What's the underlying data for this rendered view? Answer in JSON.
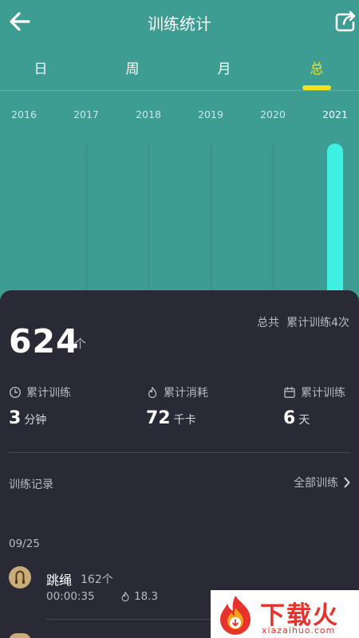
{
  "header": {
    "title": "训练统计",
    "back_icon": "arrow-left-icon",
    "share_icon": "share-icon"
  },
  "tabs": [
    {
      "label": "日"
    },
    {
      "label": "周"
    },
    {
      "label": "月"
    },
    {
      "label": "总",
      "active": true
    }
  ],
  "chart_data": {
    "type": "bar",
    "categories": [
      "2016",
      "2017",
      "2018",
      "2019",
      "2020",
      "2021"
    ],
    "values": [
      0,
      0,
      0,
      0,
      0,
      624
    ],
    "title": "",
    "xlabel": "",
    "ylabel": "",
    "ylim": [
      0,
      624
    ],
    "grid": true,
    "selected": "2021",
    "bar_color": "#3ef0e2"
  },
  "summary": {
    "total_count": "624",
    "total_unit": "个",
    "total_label": "总共",
    "sessions_text": "累计训练4次"
  },
  "stats": [
    {
      "icon": "clock-icon",
      "label": "累计训练",
      "value": "3",
      "unit": "分钟"
    },
    {
      "icon": "flame-icon",
      "label": "累计消耗",
      "value": "72",
      "unit": "千卡"
    },
    {
      "icon": "calendar-icon",
      "label": "累计训练",
      "value": "6",
      "unit": "天"
    }
  ],
  "records": {
    "title": "训练记录",
    "all_label": "全部训练",
    "date": "09/25",
    "items": [
      {
        "icon": "jump-rope-icon",
        "name": "跳绳",
        "count": "162个",
        "duration": "00:00:35",
        "calories": "18.3"
      }
    ]
  },
  "watermark": {
    "text": "下载火",
    "sub": "xiazaihuo.com"
  },
  "colors": {
    "header_bg": "#3d9d92",
    "accent": "#f5e21b",
    "panel_bg": "#2a2a36",
    "bar": "#3ef0e2"
  }
}
